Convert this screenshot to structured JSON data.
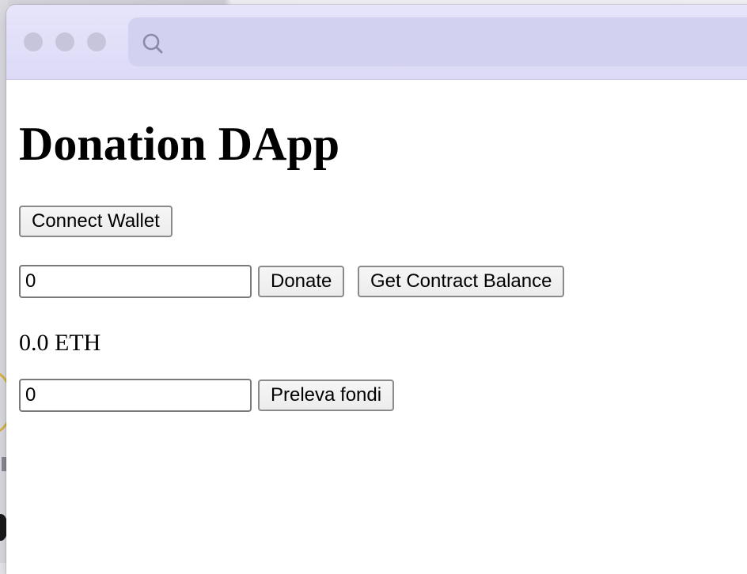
{
  "page": {
    "heading": "Donation DApp",
    "connect_label": "Connect Wallet",
    "donate": {
      "amount_value": "0",
      "button_label": "Donate"
    },
    "balance_button_label": "Get Contract Balance",
    "balance_text": "0.0 ETH",
    "withdraw": {
      "amount_value": "0",
      "button_label": "Preleva fondi"
    }
  },
  "browser": {
    "search_icon": "search-icon",
    "window_dots": [
      "close",
      "minimize",
      "zoom"
    ]
  }
}
